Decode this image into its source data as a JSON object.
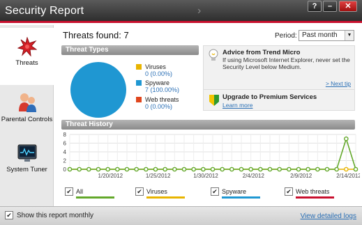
{
  "window": {
    "title": "Security Report",
    "help_label": "?",
    "minimize_label": "–",
    "close_label": "✕"
  },
  "sidebar": {
    "items": [
      {
        "label": "Threats",
        "icon": "threat-burst-icon",
        "selected": true
      },
      {
        "label": "Parental Controls",
        "icon": "parental-people-icon",
        "selected": false
      },
      {
        "label": "System Tuner",
        "icon": "system-tuner-monitor-icon",
        "selected": false
      }
    ]
  },
  "summary": {
    "threats_found": "Threats found: 7",
    "period_label": "Period:",
    "period_value": "Past month"
  },
  "threat_types": {
    "heading": "Threat Types",
    "items": [
      {
        "name": "Viruses",
        "value": "0 (0.00%)",
        "color": "#e8b400"
      },
      {
        "name": "Spyware",
        "value": "7 (100.00%)",
        "color": "#1f97d2"
      },
      {
        "name": "Web threats",
        "value": "0 (0.00%)",
        "color": "#e0461e"
      }
    ]
  },
  "advice": {
    "title": "Advice from Trend Micro",
    "text": "If using Microsoft Internet Explorer, never set the Security Level below Medium.",
    "next_tip": "> Next tip",
    "upgrade_title": "Upgrade to Premium Services",
    "learn_more": "Learn more"
  },
  "history": {
    "heading": "Threat History",
    "checkboxes": [
      {
        "label": "All",
        "checked": true,
        "color": "#63a82a"
      },
      {
        "label": "Viruses",
        "checked": true,
        "color": "#e8b400"
      },
      {
        "label": "Spyware",
        "checked": true,
        "color": "#1f97d2"
      },
      {
        "label": "Web threats",
        "checked": true,
        "color": "#c8102e"
      }
    ]
  },
  "chart_data": {
    "type": "line",
    "ylim": [
      0,
      8
    ],
    "y_ticks": [
      "0",
      "2",
      "4",
      "6",
      "8"
    ],
    "x_tick_labels": [
      "1/20/2012",
      "1/25/2012",
      "1/30/2012",
      "2/4/2012",
      "2/9/2012",
      "2/14/2012"
    ],
    "point_count": 31,
    "series": [
      {
        "name": "All",
        "color": "#63a82a",
        "values": [
          0,
          0,
          0,
          0,
          0,
          0,
          0,
          0,
          0,
          0,
          0,
          0,
          0,
          0,
          0,
          0,
          0,
          0,
          0,
          0,
          0,
          0,
          0,
          0,
          0,
          0,
          0,
          0,
          0,
          7,
          0
        ]
      },
      {
        "name": "Viruses",
        "color": "#e8b400",
        "values": [
          0,
          0,
          0,
          0,
          0,
          0,
          0,
          0,
          0,
          0,
          0,
          0,
          0,
          0,
          0,
          0,
          0,
          0,
          0,
          0,
          0,
          0,
          0,
          0,
          0,
          0,
          0,
          0,
          0,
          0,
          0
        ]
      }
    ],
    "grid": true
  },
  "footer": {
    "checkbox_label": "Show this report monthly",
    "checked": true,
    "link": "View detailed logs"
  }
}
